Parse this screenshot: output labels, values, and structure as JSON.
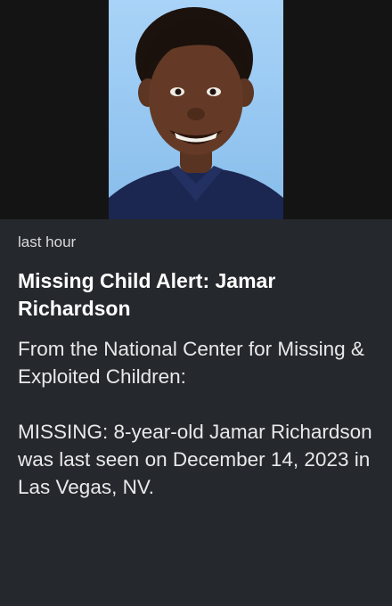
{
  "alert": {
    "timestamp": "last hour",
    "headline": "Missing Child Alert: Jamar Richardson",
    "source": "From the National Center for Missing & Exploited Children:",
    "body": "MISSING: 8-year-old Jamar Richardson was last seen on December 14, 2023 in Las Vegas, NV."
  },
  "colors": {
    "background": "#25282c",
    "photo_band": "#141414",
    "photo_backdrop": "#a9d3f7"
  }
}
